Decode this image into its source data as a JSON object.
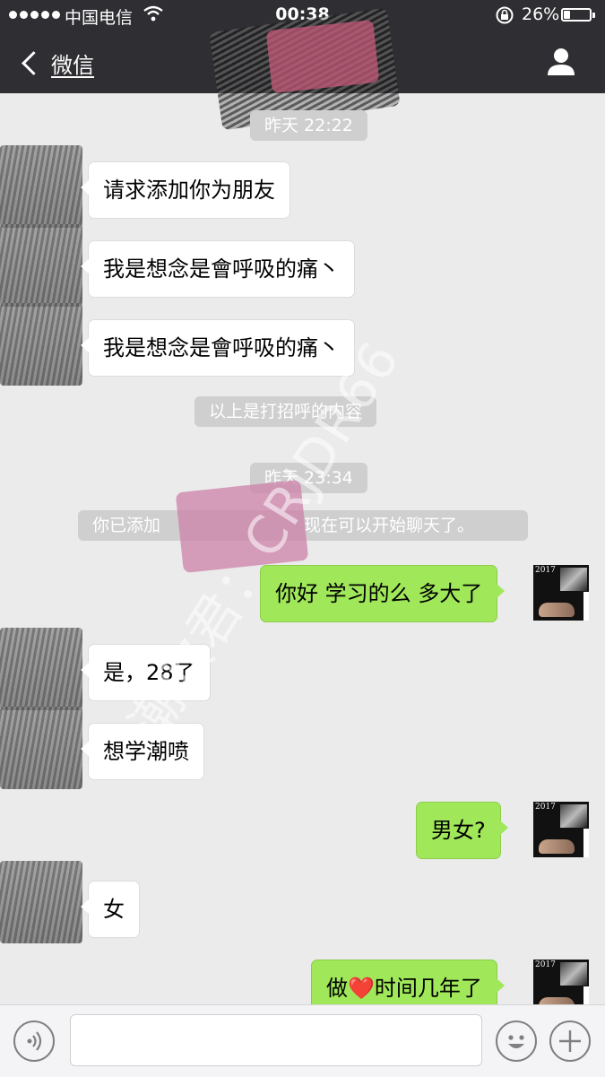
{
  "status_bar": {
    "carrier": "中国电信",
    "time": "00:38",
    "battery": "26%",
    "battery_level": 0.26
  },
  "nav": {
    "back_label": "微信"
  },
  "chat": {
    "timestamps": [
      "昨天 22:22",
      "昨天 23:34"
    ],
    "system_messages": [
      "以上是打招呼的内容",
      "你已添加",
      "现在可以开始聊天了。"
    ],
    "messages": [
      {
        "side": "in",
        "text": "请求添加你为朋友"
      },
      {
        "side": "in",
        "text": "我是想念是會呼吸的痛丶"
      },
      {
        "side": "in",
        "text": "我是想念是會呼吸的痛丶"
      },
      {
        "side": "out",
        "text": "你好 学习的么 多大了"
      },
      {
        "side": "in",
        "text": "是，28了"
      },
      {
        "side": "in",
        "text": "想学潮喷"
      },
      {
        "side": "out",
        "text": "男女?"
      },
      {
        "side": "in",
        "text": "女"
      },
      {
        "side": "out",
        "text_before": "做",
        "emoji": "❤️",
        "text_after": "时间几年了"
      }
    ],
    "self_avatar_year": "2017",
    "watermark": "潮吹君：CRJDR66"
  },
  "input": {
    "value": "",
    "placeholder": ""
  },
  "colors": {
    "nav_bg": "#2e2e33",
    "chat_bg": "#ebebeb",
    "outgoing_bubble": "#a0e75a",
    "incoming_bubble": "#ffffff"
  },
  "icons": [
    "signal-icon",
    "wifi-icon",
    "lock-rotation-icon",
    "battery-icon",
    "back-chevron-icon",
    "profile-icon",
    "voice-icon",
    "emoji-icon",
    "plus-icon"
  ]
}
